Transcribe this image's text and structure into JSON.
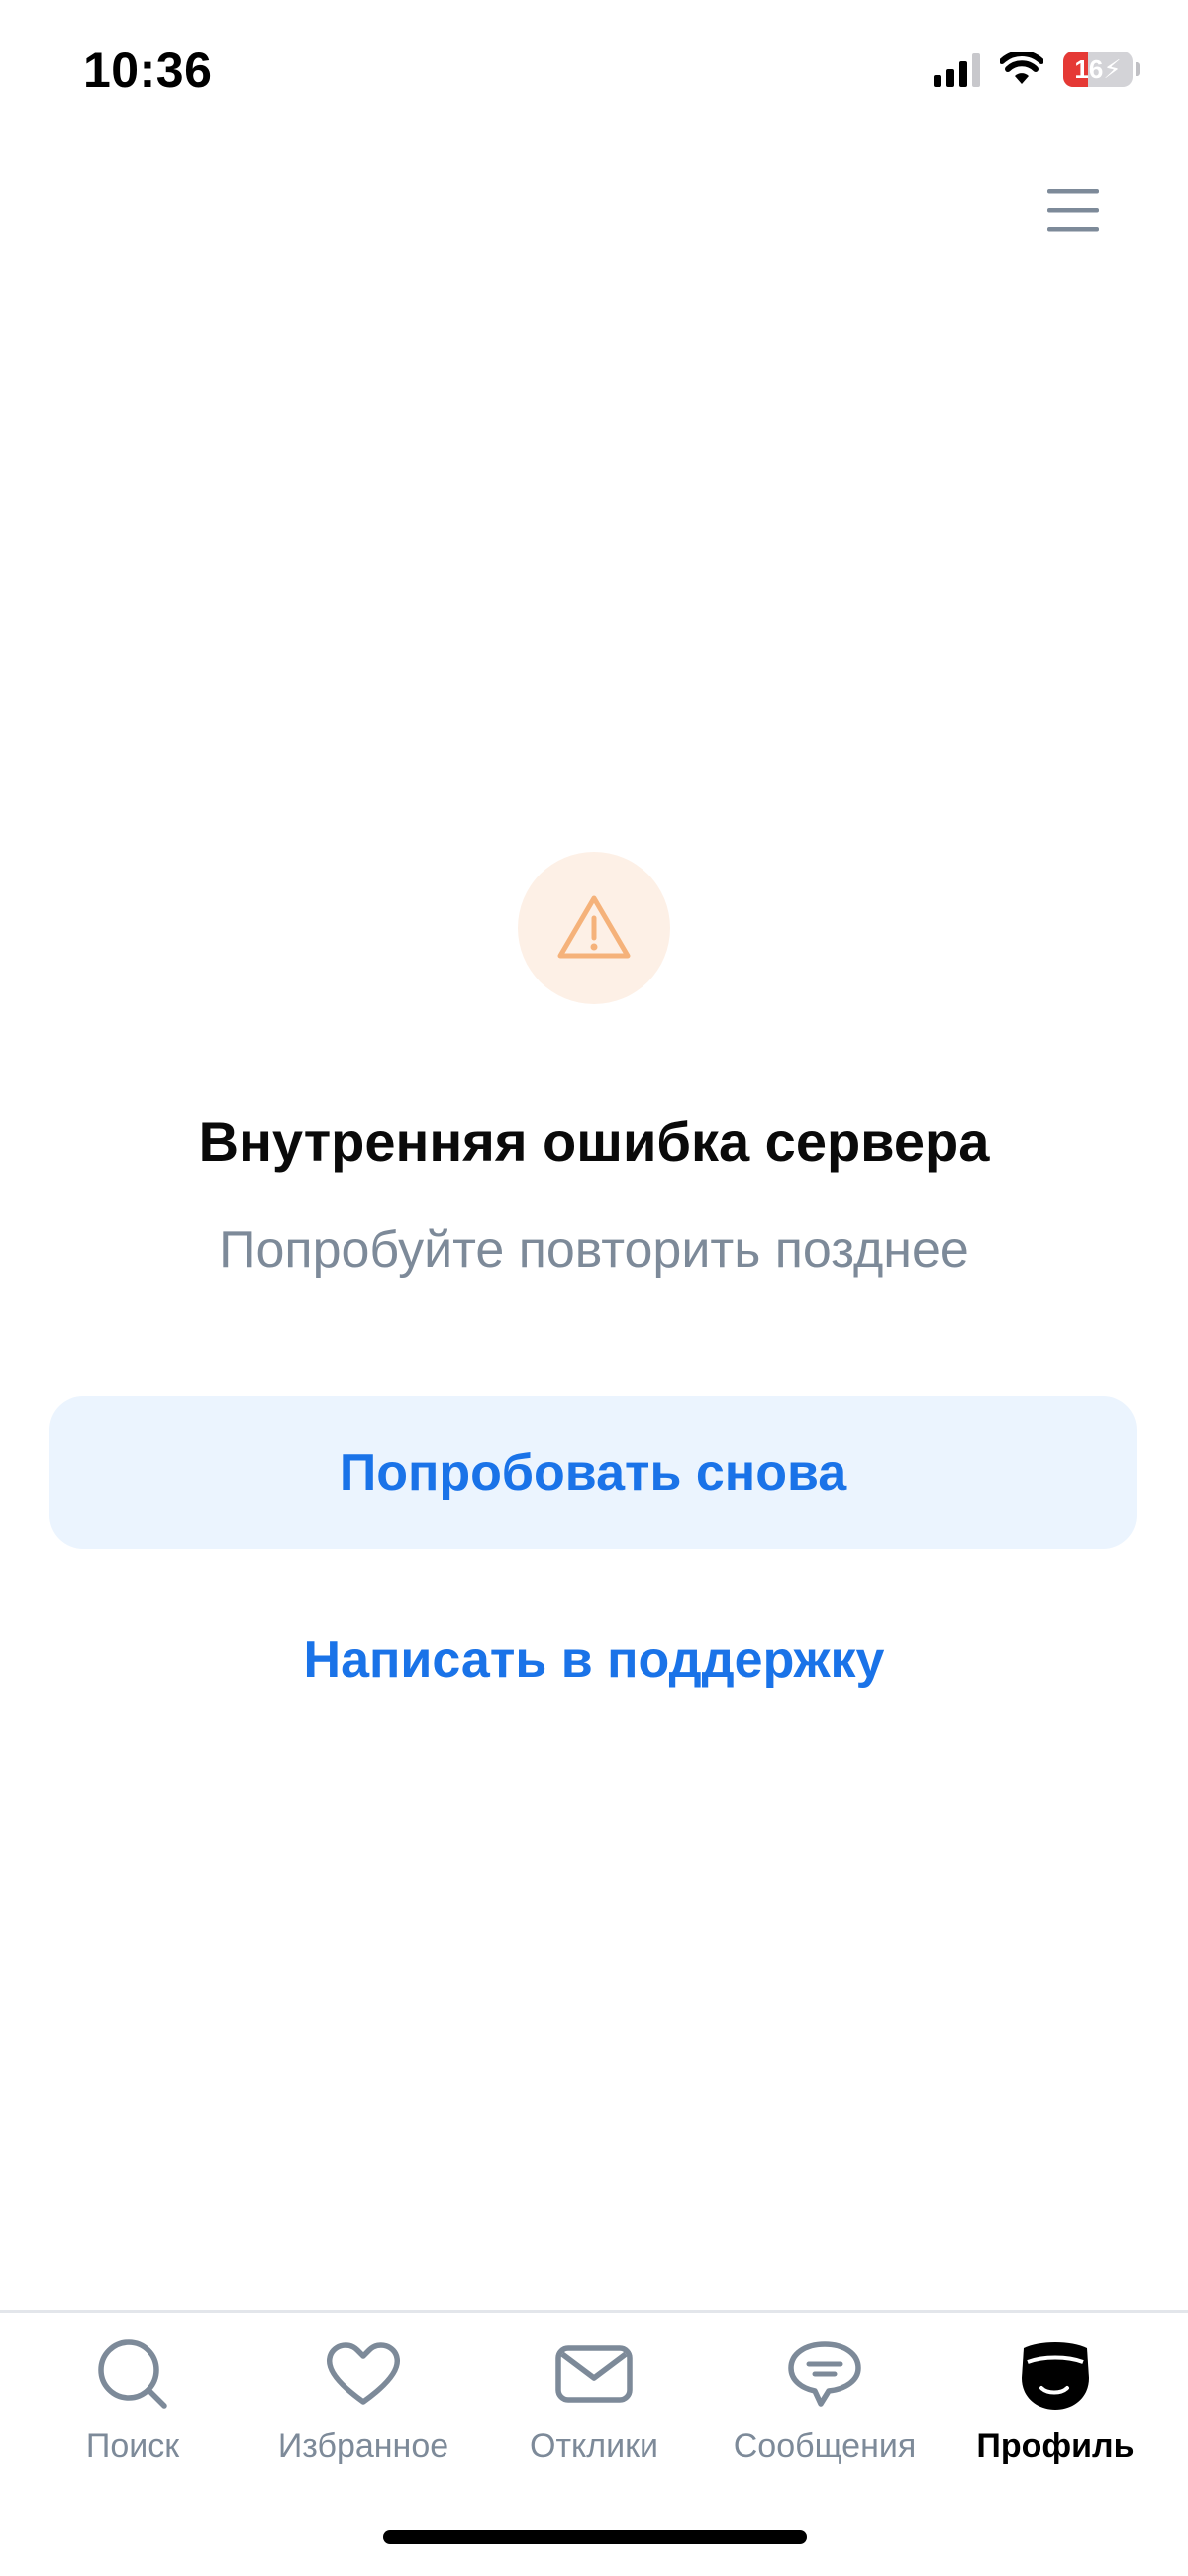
{
  "status_bar": {
    "time": "10:36",
    "battery_level": "16",
    "battery_fraction": 0.16,
    "battery_color": "#e53935"
  },
  "header": {
    "menu_icon": "hamburger-menu-icon"
  },
  "error": {
    "icon": "warning-triangle-icon",
    "icon_color": "#f5b27a",
    "icon_bg": "#fdf0e6",
    "title": "Внутренняя ошибка сервера",
    "subtitle": "Попробуйте повторить позднее"
  },
  "actions": {
    "retry_label": "Попробовать снова",
    "support_label": "Написать в поддержку",
    "accent_color": "#1a73e8"
  },
  "tab_bar": {
    "active_index": 4,
    "tabs": [
      {
        "label": "Поиск",
        "icon": "search-icon"
      },
      {
        "label": "Избранное",
        "icon": "heart-icon"
      },
      {
        "label": "Отклики",
        "icon": "envelope-icon"
      },
      {
        "label": "Сообщения",
        "icon": "chat-bubble-icon"
      },
      {
        "label": "Профиль",
        "icon": "profile-mask-icon"
      }
    ]
  }
}
